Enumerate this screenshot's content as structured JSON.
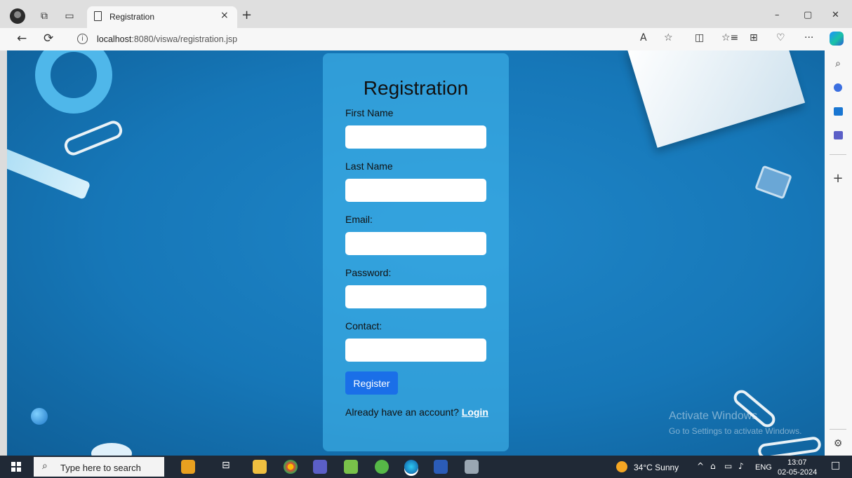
{
  "browser": {
    "tab_title": "Registration",
    "tab_close": "×",
    "new_tab": "+",
    "url_host": "localhost",
    "url_path": ":8080/viswa/registration.jsp",
    "window_controls": {
      "minimize": "–",
      "restore": "▢",
      "close": "✕"
    }
  },
  "toolbar": {
    "back": "←",
    "refresh": "⟳",
    "info": "i",
    "read_aloud": "A",
    "favorite": "☆",
    "split": "◫",
    "favorites": "☆≡",
    "collections": "⊞",
    "health": "♡",
    "more": "···"
  },
  "form": {
    "title": "Registration",
    "fields": [
      {
        "label": "First Name",
        "value": ""
      },
      {
        "label": "Last Name",
        "value": ""
      },
      {
        "label": "Email:",
        "value": ""
      },
      {
        "label": "Password:",
        "value": ""
      },
      {
        "label": "Contact:",
        "value": ""
      }
    ],
    "register_label": "Register",
    "login_prompt": "Already have an account?",
    "login_link": "Login"
  },
  "watermark": {
    "line1": "Activate Windows",
    "line2": "Go to Settings to activate Windows."
  },
  "sidebar": {
    "search": "⌕",
    "add": "+",
    "settings": "⚙"
  },
  "taskbar": {
    "search_placeholder": "Type here to search",
    "weather": "34°C  Sunny",
    "tray_up": "^",
    "language": "ENG",
    "time": "13:07",
    "date": "02-05-2024",
    "notifications": "□"
  },
  "colors": {
    "accent_button": "#1a6fe8",
    "card_background": "#40b4ec",
    "page_background": "#1677b8"
  }
}
